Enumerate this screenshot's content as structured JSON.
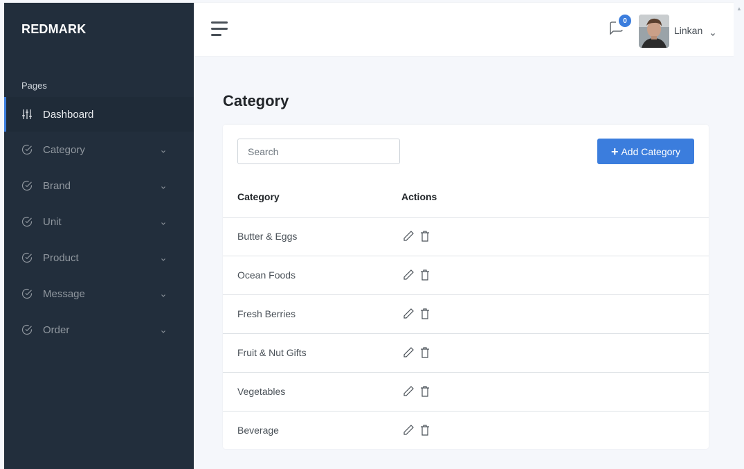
{
  "brand": "REDMARK",
  "sidebar": {
    "section_header": "Pages",
    "items": [
      {
        "label": "Dashboard",
        "icon": "sliders-icon",
        "active": true,
        "has_chevron": false
      },
      {
        "label": "Category",
        "icon": "check-circle-icon",
        "active": false,
        "has_chevron": true
      },
      {
        "label": "Brand",
        "icon": "check-circle-icon",
        "active": false,
        "has_chevron": true
      },
      {
        "label": "Unit",
        "icon": "check-circle-icon",
        "active": false,
        "has_chevron": true
      },
      {
        "label": "Product",
        "icon": "check-circle-icon",
        "active": false,
        "has_chevron": true
      },
      {
        "label": "Message",
        "icon": "check-circle-icon",
        "active": false,
        "has_chevron": true
      },
      {
        "label": "Order",
        "icon": "check-circle-icon",
        "active": false,
        "has_chevron": true
      }
    ]
  },
  "topbar": {
    "message_count": "0",
    "user_name": "Linkan"
  },
  "main": {
    "title": "Category",
    "search_placeholder": "Search",
    "add_button_label": "Add Category",
    "table": {
      "headers": [
        "Category",
        "Actions"
      ],
      "rows": [
        {
          "name": "Butter & Eggs"
        },
        {
          "name": "Ocean Foods"
        },
        {
          "name": "Fresh Berries"
        },
        {
          "name": "Fruit & Nut Gifts"
        },
        {
          "name": "Vegetables"
        },
        {
          "name": "Beverage"
        }
      ]
    }
  },
  "colors": {
    "sidebar_bg": "#222e3c",
    "accent": "#3b7ddd",
    "page_bg": "#f5f7fb"
  }
}
